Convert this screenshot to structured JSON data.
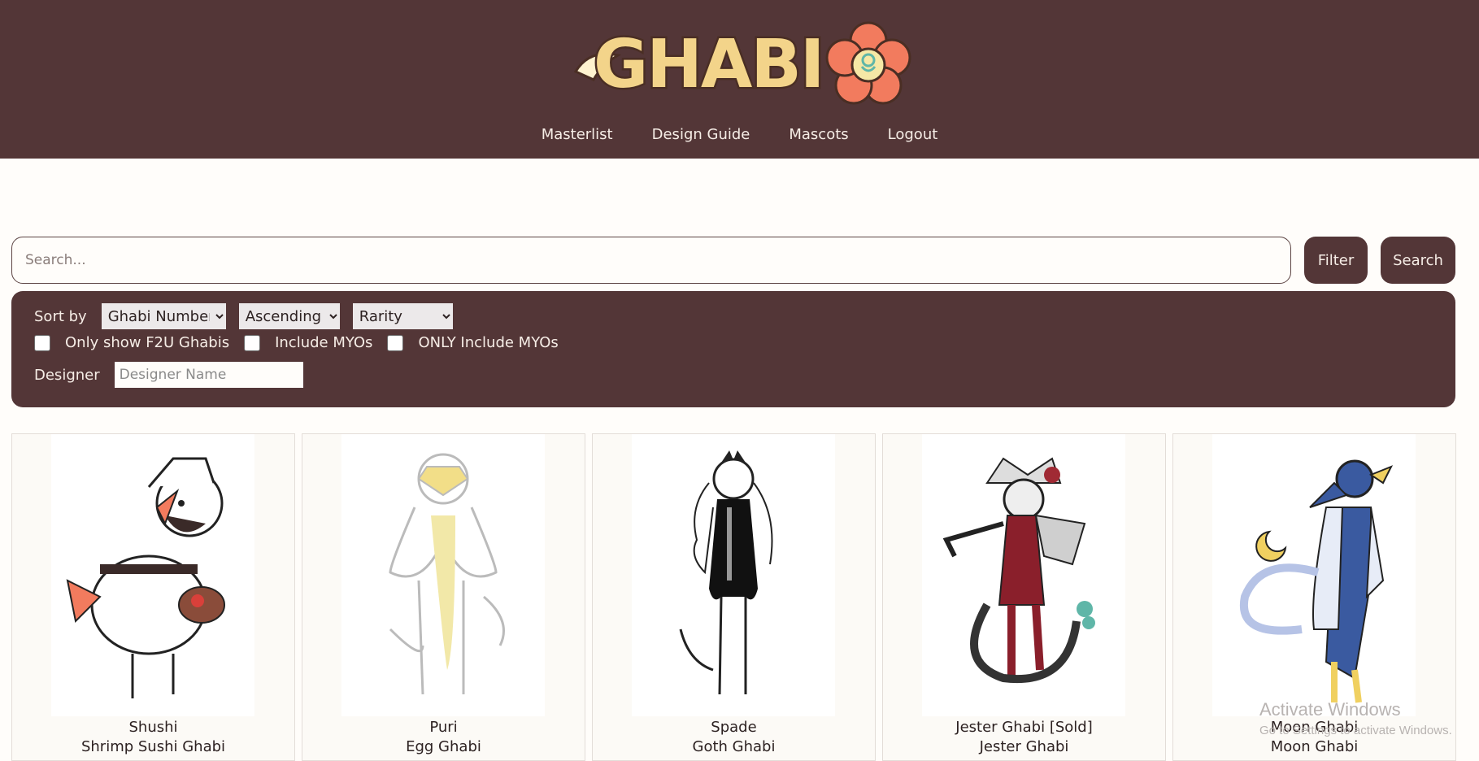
{
  "header": {
    "logo_text": "GHABI",
    "nav": [
      "Masterlist",
      "Design Guide",
      "Mascots",
      "Logout"
    ]
  },
  "search": {
    "placeholder": "Search...",
    "filter_label": "Filter",
    "search_label": "Search"
  },
  "filters": {
    "sort_by_label": "Sort by",
    "sort_field": "Ghabi Number",
    "sort_order": "Ascending",
    "rarity": "Rarity",
    "only_f2u_label": "Only show F2U Ghabis",
    "include_myos_label": "Include MYOs",
    "only_myos_label": "ONLY Include MYOs",
    "designer_label": "Designer",
    "designer_placeholder": "Designer Name"
  },
  "cards": [
    {
      "name": "Shushi",
      "type": "Shrimp Sushi Ghabi"
    },
    {
      "name": "Puri",
      "type": "Egg Ghabi"
    },
    {
      "name": "Spade",
      "type": "Goth Ghabi"
    },
    {
      "name": "Jester Ghabi [Sold]",
      "type": "Jester Ghabi"
    },
    {
      "name": "Moon Ghabi",
      "type": "Moon Ghabi"
    }
  ],
  "watermark": {
    "title": "Activate Windows",
    "subtitle": "Go to Settings to activate Windows."
  },
  "colors": {
    "brand_brown": "#533637",
    "page_bg": "#fffdfa"
  }
}
